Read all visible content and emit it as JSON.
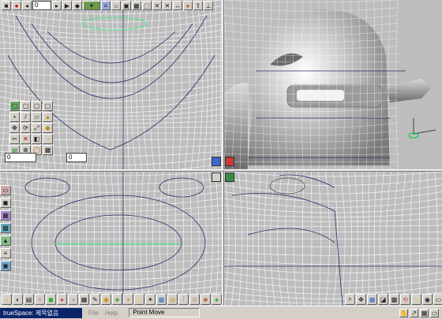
{
  "toolbar": {
    "frame_value": "0",
    "icons": [
      "stop-icon",
      "record-icon",
      "rewind-icon",
      "step-back-icon",
      "step-forward-icon",
      "play-icon",
      "keyframe-icon",
      "render-icon",
      "material-icon",
      "light-icon",
      "camera-icon",
      "grid-icon",
      "select-icon",
      "deform-icon",
      "close-icon",
      "arrow-icon",
      "sphere-icon",
      "move-up-icon",
      "pin-icon"
    ]
  },
  "point_panel": {
    "spin_left": "0",
    "spin_right": "0"
  },
  "taskbar": {
    "title": "trueSpace: 제목없음",
    "menu_file": "File",
    "menu_help": "Help",
    "status": "Point Move"
  },
  "colors": {
    "viewport_bg": "#bdbdbd",
    "wire": "#ffffff",
    "wire_dark": "#2a2a6a",
    "selection": "#00ff66",
    "title_bar": "#0a246a"
  }
}
